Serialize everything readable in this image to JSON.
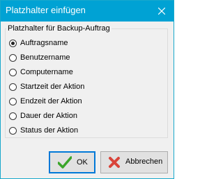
{
  "window": {
    "title": "Platzhalter einfügen"
  },
  "group": {
    "legend": "Platzhalter für Backup-Auftrag",
    "options": [
      {
        "label": "Auftragsname",
        "checked": true
      },
      {
        "label": "Benutzername",
        "checked": false
      },
      {
        "label": "Computername",
        "checked": false
      },
      {
        "label": "Startzeit der Aktion",
        "checked": false
      },
      {
        "label": "Endzeit der Aktion",
        "checked": false
      },
      {
        "label": "Dauer der Aktion",
        "checked": false
      },
      {
        "label": "Status der Aktion",
        "checked": false
      }
    ]
  },
  "buttons": {
    "ok_label": "OK",
    "cancel_label": "Abbrechen"
  },
  "icons": {
    "close": "close-icon",
    "ok": "checkmark-icon",
    "cancel": "cross-icon"
  },
  "colors": {
    "titlebar": "#00a2d4",
    "ok_check": "#3aa52a",
    "cancel_cross": "#d9443a",
    "focus_border": "#0078d7"
  }
}
